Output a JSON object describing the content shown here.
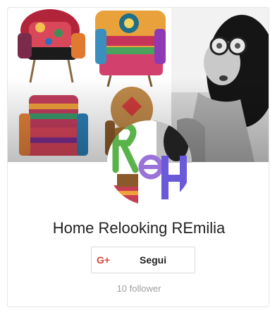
{
  "profile": {
    "name": "Home Relooking REmilia",
    "follow_label": "Segui",
    "gplus_label": "G+",
    "followers": "10 follower"
  },
  "colors": {
    "gplus_red": "#db4437",
    "border": "#e6e6e6",
    "follower_text": "#9e9e9e",
    "name_text": "#212121"
  },
  "icons": {
    "google_plus": "google-plus-icon"
  }
}
